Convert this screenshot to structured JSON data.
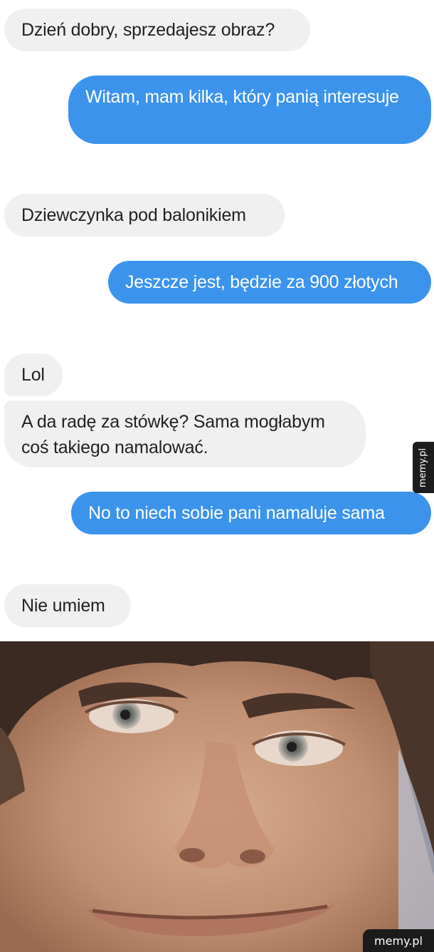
{
  "messages": [
    {
      "side": "incoming",
      "text": "Dzień dobry, sprzedajesz obraz?"
    },
    {
      "side": "outgoing",
      "text": "Witam, mam kilka, który panią interesuje"
    },
    {
      "side": "incoming",
      "text": "Dziewczynka pod balonikiem"
    },
    {
      "side": "outgoing",
      "text": "Jeszcze jest, będzie za 900 złotych"
    },
    {
      "side": "incoming",
      "text": "Lol"
    },
    {
      "side": "incoming",
      "text": "A da radę za stówkę? Sama mogłabym coś takiego namalować."
    },
    {
      "side": "outgoing",
      "text": "No to niech sobie pani namaluje sama"
    },
    {
      "side": "incoming",
      "text": "Nie umiem"
    }
  ],
  "watermarks": {
    "side": "memy.pl",
    "corner": "memy.pl"
  },
  "reaction_image": {
    "description_icon": "face-closeup-photo"
  },
  "colors": {
    "incoming_bubble": "#f1f0f0",
    "outgoing_bubble": "#3b93ec",
    "incoming_text": "#222222",
    "outgoing_text": "#ffffff"
  }
}
